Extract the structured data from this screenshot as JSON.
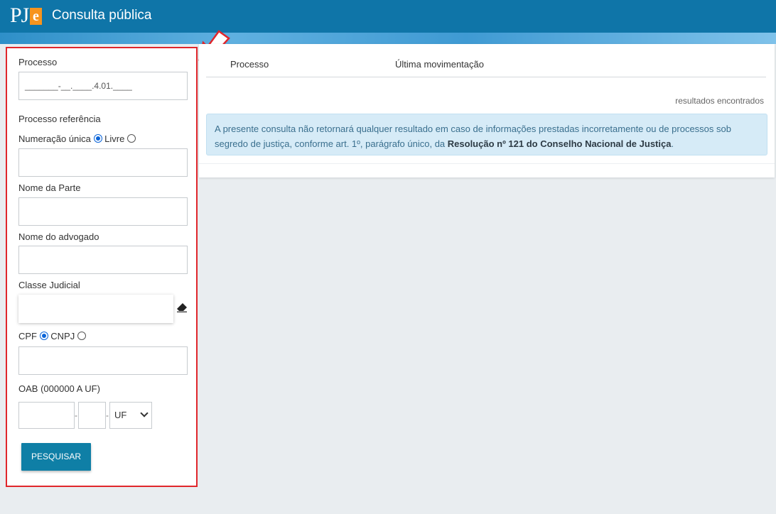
{
  "header": {
    "logo_text": "PJ",
    "logo_accent": "e",
    "title": "Consulta pública",
    "color": "#0f75a8"
  },
  "form": {
    "processo_label": "Processo",
    "processo_value": "_______-__.____.4.01.____",
    "processo_ref_label": "Processo referência",
    "numeracao_unica_label": "Numeração única",
    "livre_label": "Livre",
    "nome_parte_label": "Nome da Parte",
    "nome_advogado_label": "Nome do advogado",
    "classe_judicial_label": "Classe Judicial",
    "cpf_label": "CPF",
    "cnpj_label": "CNPJ",
    "oab_label": "OAB (000000 A UF)",
    "oab_separator": "-",
    "uf_selected": "UF",
    "search_button": "PESQUISAR"
  },
  "results": {
    "columns": [
      "Processo",
      "Última movimentação"
    ],
    "count_text": "resultados encontrados",
    "notice_text": "A presente consulta não retornará qualquer resultado em caso de informações prestadas incorretamente ou de processos sob segredo de justiça, conforme art. 1º, parágrafo único, da ",
    "notice_bold": "Resolução nº 121 do Conselho Nacional de Justiça",
    "notice_end": "."
  },
  "icons": {
    "eraser": "eraser-icon",
    "arrow": "arrow-annotation-icon"
  },
  "colors": {
    "highlight_border": "#e0262b",
    "button": "#0f7fa6",
    "notice_bg": "#d6ebf7",
    "logo_orange": "#f7941d"
  }
}
